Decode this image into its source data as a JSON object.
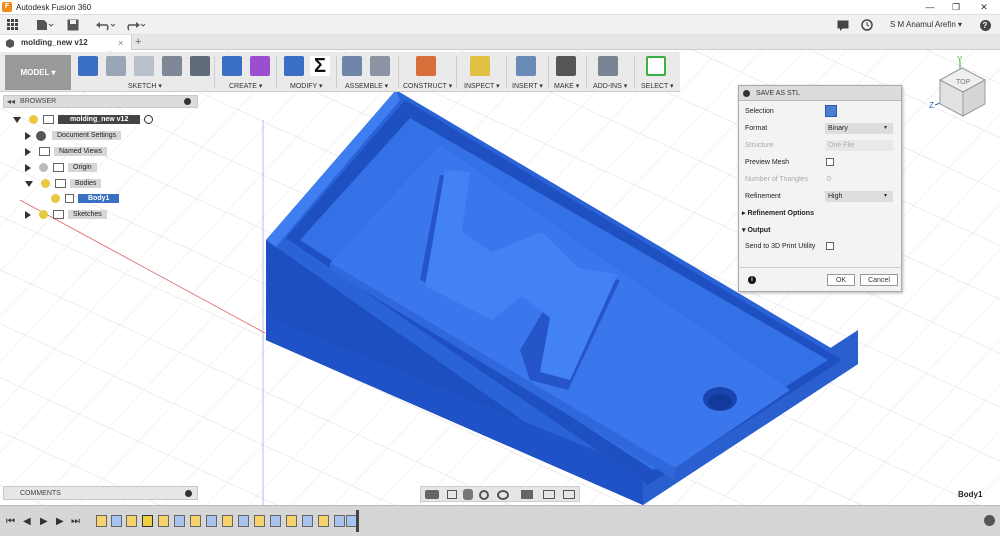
{
  "window": {
    "app_title": "Autodesk Fusion 360",
    "minimize": "—",
    "restore": "❐",
    "close": "✕"
  },
  "quick_access": {
    "user_name": "S M Anamul Arefin ▾",
    "help": "?"
  },
  "document_tab": {
    "label": "molding_new v12",
    "close": "×",
    "new_tab": "+"
  },
  "toolbar": {
    "workspace": "MODEL ▾",
    "groups": [
      "SKETCH ▾",
      "CREATE ▾",
      "MODIFY ▾",
      "ASSEMBLE ▾",
      "CONSTRUCT ▾",
      "INSPECT ▾",
      "INSERT ▾",
      "MAKE ▾",
      "ADD-INS ▾",
      "SELECT ▾"
    ],
    "accent_color": "#3a6fc4"
  },
  "browser": {
    "title": "BROWSER",
    "root": "molding_new v12",
    "items": [
      "Document Settings",
      "Named Views",
      "Origin",
      "Bodies",
      "Body1",
      "Sketches"
    ]
  },
  "dialog": {
    "title": "SAVE AS STL",
    "rows": [
      {
        "label": "Selection",
        "value": ""
      },
      {
        "label": "Format",
        "value": "Binary"
      },
      {
        "label": "Structure",
        "value": "One File"
      },
      {
        "label": "Preview Mesh",
        "value": ""
      },
      {
        "label": "Number of Triangles",
        "value": "0"
      },
      {
        "label": "Refinement",
        "value": "High"
      }
    ],
    "refinement_options": "Refinement Options",
    "output": "Output",
    "send_to_print": "Send to 3D Print Utility",
    "ok": "OK",
    "cancel": "Cancel"
  },
  "comments": {
    "title": "COMMENTS"
  },
  "viewcube": {
    "face_label": "TOP",
    "axis_y": "Y",
    "axis_z": "Z"
  },
  "selection_label": "Body1",
  "model_color": "#2a5fd0"
}
